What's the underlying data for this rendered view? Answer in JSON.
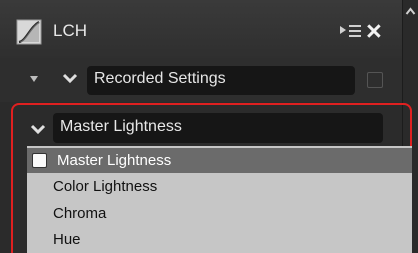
{
  "panel": {
    "title": "LCH",
    "logo_icon": "lch-curve-icon",
    "menu_icon": "panel-menu-icon",
    "close_icon": "close-icon"
  },
  "recorded_settings": {
    "label": "Recorded Settings",
    "checked": false
  },
  "channel_select": {
    "value": "Master Lightness",
    "options": [
      {
        "label": "Master Lightness",
        "selected": true
      },
      {
        "label": "Color Lightness",
        "selected": false
      },
      {
        "label": "Chroma",
        "selected": false
      },
      {
        "label": "Hue",
        "selected": false
      }
    ]
  },
  "colors": {
    "highlight": "#e02020",
    "dropdown_bg": "#c6c6c6",
    "selected_option_bg": "#6b6b6b"
  }
}
